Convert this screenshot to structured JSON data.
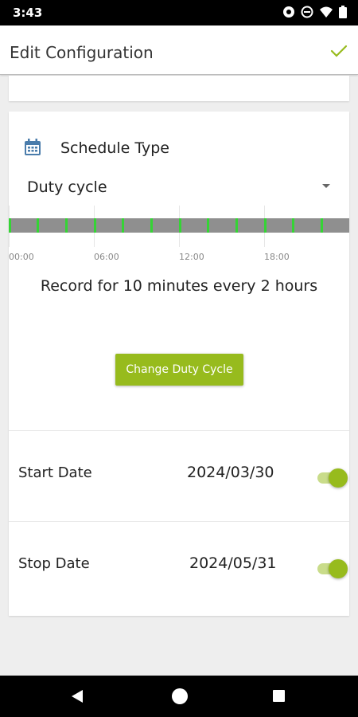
{
  "status_bar": {
    "time": "3:43",
    "icons": [
      "eye-icon",
      "do-not-disturb-icon",
      "wifi-icon",
      "battery-icon"
    ]
  },
  "app_bar": {
    "title": "Edit Configuration",
    "confirm_icon": "check-icon"
  },
  "schedule": {
    "icon": "calendar-icon",
    "label": "Schedule Type",
    "selected": "Duty cycle",
    "timeline_labels": [
      "00:00",
      "06:00",
      "12:00",
      "18:00"
    ],
    "summary": "Record for 10 minutes every 2 hours",
    "change_button": "Change Duty Cycle"
  },
  "start_date": {
    "label": "Start Date",
    "value": "2024/03/30",
    "enabled": true
  },
  "stop_date": {
    "label": "Stop Date",
    "value": "2024/05/31",
    "enabled": true
  },
  "colors": {
    "accent": "#97bb1d",
    "timeline_bar": "#8f8f8f",
    "timeline_tick": "#35d435"
  },
  "nav_bar": {
    "icons": [
      "back-icon",
      "home-icon",
      "recents-icon"
    ]
  }
}
